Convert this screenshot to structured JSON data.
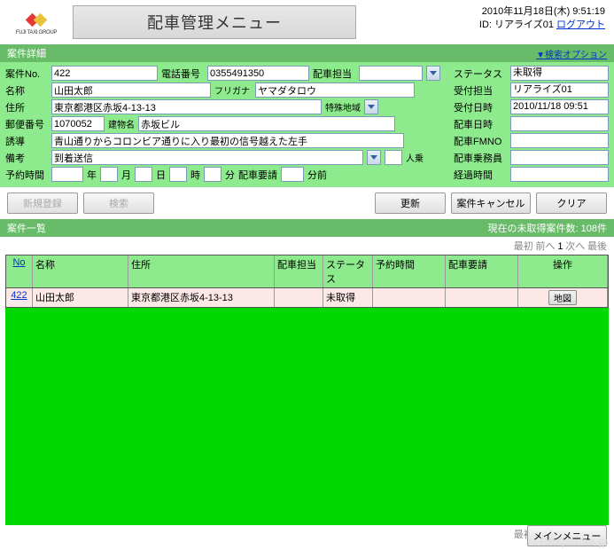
{
  "header": {
    "datetime": "2010年11月18日(木) 9:51:19",
    "id_label": "ID:",
    "id_value": "リアライズ01",
    "logout": "ログアウト",
    "title": "配車管理メニュー",
    "logo_text": "FUJI TAXI GROUP"
  },
  "sectionDetail": {
    "title": "案件詳細",
    "search_opt": "▼検索オプション"
  },
  "form": {
    "caseNo": {
      "label": "案件No.",
      "value": "422"
    },
    "tel": {
      "label": "電話番号",
      "value": "0355491350"
    },
    "dispatch": {
      "label": "配車担当",
      "value": ""
    },
    "name": {
      "label": "名称",
      "value": "山田太郎"
    },
    "furigana": {
      "label": "フリガナ",
      "value": "ヤマダタロウ"
    },
    "address": {
      "label": "住所",
      "value": "東京都港区赤坂4-13-13"
    },
    "special": {
      "label": "特殊地域"
    },
    "postal": {
      "label": "郵便番号",
      "value": "1070052"
    },
    "building": {
      "label": "建物名",
      "value": "赤坂ビル"
    },
    "guide": {
      "label": "誘導",
      "value": "青山通りからコロンビア通りに入り最初の信号越えた左手"
    },
    "note": {
      "label": "備考",
      "value": "到着送信"
    },
    "passengers": {
      "label": "人乗"
    },
    "reserve": {
      "label": "予約時間",
      "year": "年",
      "month": "月",
      "day": "日",
      "hour": "時",
      "min": "分",
      "req": "配車要請",
      "before": "分前"
    }
  },
  "right": {
    "status": {
      "label": "ステータス",
      "value": "未取得"
    },
    "recv_by": {
      "label": "受付担当",
      "value": "リアライズ01"
    },
    "recv_dt": {
      "label": "受付日時",
      "value": "2010/11/18 09:51"
    },
    "disp_dt": {
      "label": "配車日時",
      "value": ""
    },
    "fmno": {
      "label": "配車FMNO",
      "value": ""
    },
    "crew": {
      "label": "配車乗務員",
      "value": ""
    },
    "elapsed": {
      "label": "経過時間",
      "value": ""
    }
  },
  "buttons": {
    "new": "新規登録",
    "search": "検索",
    "update": "更新",
    "cancel": "案件キャンセル",
    "clear": "クリア",
    "main": "メインメニュー",
    "map": "地図"
  },
  "list": {
    "title": "案件一覧",
    "count": "現在の未取得案件数: 108件"
  },
  "pager": {
    "first": "最初",
    "prev": "前へ",
    "cur": "1",
    "next": "次へ",
    "last": "最後"
  },
  "cols": {
    "no": "No",
    "name": "名称",
    "addr": "住所",
    "disp": "配車担当",
    "stat": "ステータス",
    "res": "予約時間",
    "req": "配車要請",
    "op": "操作"
  },
  "rows": [
    {
      "no": "422",
      "name": "山田太郎",
      "addr": "東京都港区赤坂4-13-13",
      "disp": "",
      "stat": "未取得",
      "res": "",
      "req": ""
    }
  ],
  "watermark": "Response.jp"
}
